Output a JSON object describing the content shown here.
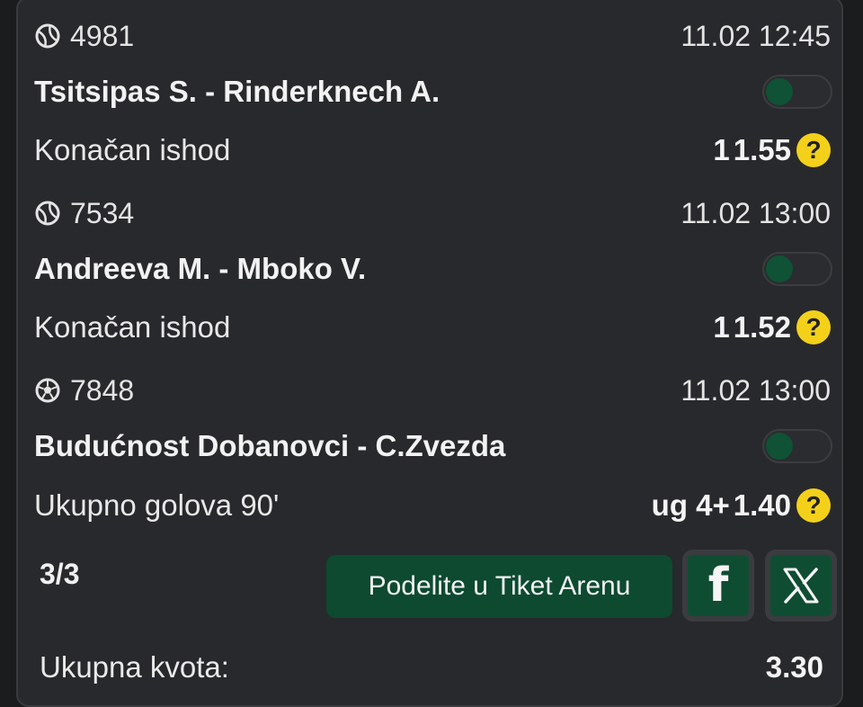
{
  "matches": [
    {
      "sport_icon": "tennis-ball-icon",
      "code": "4981",
      "datetime": "11.02 12:45",
      "teams": "Tsitsipas S. - Rinderknech A.",
      "market": "Konačan ishod",
      "pick": "1",
      "odds": "1.55"
    },
    {
      "sport_icon": "tennis-ball-icon",
      "code": "7534",
      "datetime": "11.02 13:00",
      "teams": "Andreeva M. - Mboko V.",
      "market": "Konačan ishod",
      "pick": "1",
      "odds": "1.52"
    },
    {
      "sport_icon": "soccer-ball-icon",
      "code": "7848",
      "datetime": "11.02 13:00",
      "teams": "Budućnost Dobanovci - C.Zvezda",
      "market": "Ukupno golova 90'",
      "pick": "ug 4+",
      "odds": "1.40"
    }
  ],
  "help_glyph": "?",
  "footer": {
    "count": "3/3",
    "share_label": "Podelite u Tiket Arenu",
    "facebook_glyph": "f",
    "total_label": "Ukupna kvota:",
    "total_value": "3.30"
  },
  "colors": {
    "background": "#1b1c1e",
    "card": "#28292c",
    "accent_green": "#0d4a30",
    "help_yellow": "#f3d11a"
  }
}
